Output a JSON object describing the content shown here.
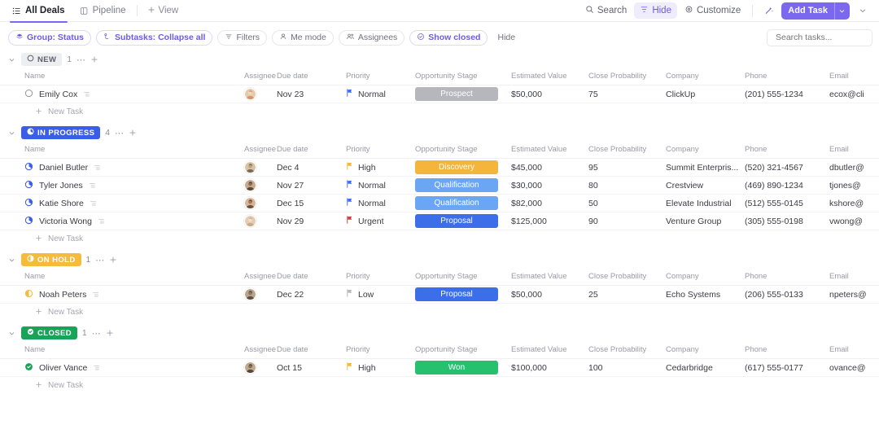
{
  "header": {
    "tabs": [
      {
        "label": "All Deals",
        "icon": "list-icon",
        "active": true
      },
      {
        "label": "Pipeline",
        "icon": "board-icon",
        "active": false
      }
    ],
    "add_view_label": "View",
    "actions": {
      "search_label": "Search",
      "hide_label": "Hide",
      "customize_label": "Customize",
      "ai_icon": "ai-sparkle-icon",
      "add_task_label": "Add Task",
      "caret_icon": "chevron-down-icon"
    }
  },
  "toolbar": {
    "group_chip": "Group: Status",
    "subtasks_chip": "Subtasks: Collapse all",
    "filters_chip": "Filters",
    "me_mode_chip": "Me mode",
    "assignees_chip": "Assignees",
    "show_closed_chip": "Show closed",
    "hide_label": "Hide",
    "search_placeholder": "Search tasks..."
  },
  "columns": [
    "Name",
    "Assignee",
    "Due date",
    "Priority",
    "Opportunity Stage",
    "Estimated Value",
    "Close Probability",
    "Company",
    "Phone",
    "Email"
  ],
  "new_task_label": "New Task",
  "colors": {
    "accent": "#7b68ee",
    "status_new": "#eceef0",
    "status_in_progress": "#3b5ee8",
    "status_on_hold": "#f5bb3c",
    "status_closed": "#19a359",
    "stage_prospect": "#b6b6bd",
    "stage_discovery": "#f5b53c",
    "stage_qualification": "#6ba6f5",
    "stage_proposal": "#3b6ee8",
    "stage_won": "#25c16f",
    "priority_high": "#f5b53c",
    "priority_normal": "#3b6ee8",
    "priority_urgent": "#cc3d3d",
    "priority_low": "#b6b6bd"
  },
  "groups": [
    {
      "status": "NEW",
      "status_key": "new",
      "status_icon": "circle-outline-icon",
      "count": "1",
      "tasks": [
        {
          "name": "Emily Cox",
          "status_icon": "circle-outline-icon",
          "assignee_avatar": "avatar-emily",
          "due_date": "Nov 23",
          "priority": "Normal",
          "priority_key": "normal",
          "stage": "Prospect",
          "stage_key": "prospect",
          "estimated_value": "$50,000",
          "close_probability": "75",
          "company": "ClickUp",
          "phone": "(201) 555-1234",
          "email": "ecox@cli"
        }
      ]
    },
    {
      "status": "IN PROGRESS",
      "status_key": "in_progress",
      "status_icon": "clock-icon",
      "count": "4",
      "tasks": [
        {
          "name": "Daniel Butler",
          "status_icon": "clock-icon",
          "assignee_avatar": "avatar-daniel",
          "due_date": "Dec 4",
          "priority": "High",
          "priority_key": "high",
          "stage": "Discovery",
          "stage_key": "discovery",
          "estimated_value": "$45,000",
          "close_probability": "95",
          "company": "Summit Enterpris...",
          "phone": "(520) 321-4567",
          "email": "dbutler@"
        },
        {
          "name": "Tyler Jones",
          "status_icon": "clock-icon",
          "assignee_avatar": "avatar-tyler",
          "due_date": "Nov 27",
          "priority": "Normal",
          "priority_key": "normal",
          "stage": "Qualification",
          "stage_key": "qualification",
          "estimated_value": "$30,000",
          "close_probability": "80",
          "company": "Crestview",
          "phone": "(469) 890-1234",
          "email": "tjones@"
        },
        {
          "name": "Katie Shore",
          "status_icon": "clock-icon",
          "assignee_avatar": "avatar-katie",
          "due_date": "Dec 15",
          "priority": "Normal",
          "priority_key": "normal",
          "stage": "Qualification",
          "stage_key": "qualification",
          "estimated_value": "$82,000",
          "close_probability": "50",
          "company": "Elevate Industrial",
          "phone": "(512) 555-0145",
          "email": "kshore@"
        },
        {
          "name": "Victoria Wong",
          "status_icon": "clock-icon",
          "assignee_avatar": "avatar-victoria",
          "due_date": "Nov 29",
          "priority": "Urgent",
          "priority_key": "urgent",
          "stage": "Proposal",
          "stage_key": "proposal",
          "estimated_value": "$125,000",
          "close_probability": "90",
          "company": "Venture Group",
          "phone": "(305) 555-0198",
          "email": "vwong@"
        }
      ]
    },
    {
      "status": "ON HOLD",
      "status_key": "on_hold",
      "status_icon": "pause-circle-icon",
      "count": "1",
      "tasks": [
        {
          "name": "Noah Peters",
          "status_icon": "pause-circle-icon",
          "assignee_avatar": "avatar-noah",
          "due_date": "Dec 22",
          "priority": "Low",
          "priority_key": "low",
          "stage": "Proposal",
          "stage_key": "proposal",
          "estimated_value": "$50,000",
          "close_probability": "25",
          "company": "Echo Systems",
          "phone": "(206) 555-0133",
          "email": "npeters@"
        }
      ]
    },
    {
      "status": "CLOSED",
      "status_key": "closed",
      "status_icon": "check-circle-icon",
      "count": "1",
      "tasks": [
        {
          "name": "Oliver Vance",
          "status_icon": "check-circle-icon",
          "assignee_avatar": "avatar-oliver",
          "due_date": "Oct 15",
          "priority": "High",
          "priority_key": "high",
          "stage": "Won",
          "stage_key": "won",
          "estimated_value": "$100,000",
          "close_probability": "100",
          "company": "Cedarbridge",
          "phone": "(617) 555-0177",
          "email": "ovance@"
        }
      ]
    }
  ]
}
